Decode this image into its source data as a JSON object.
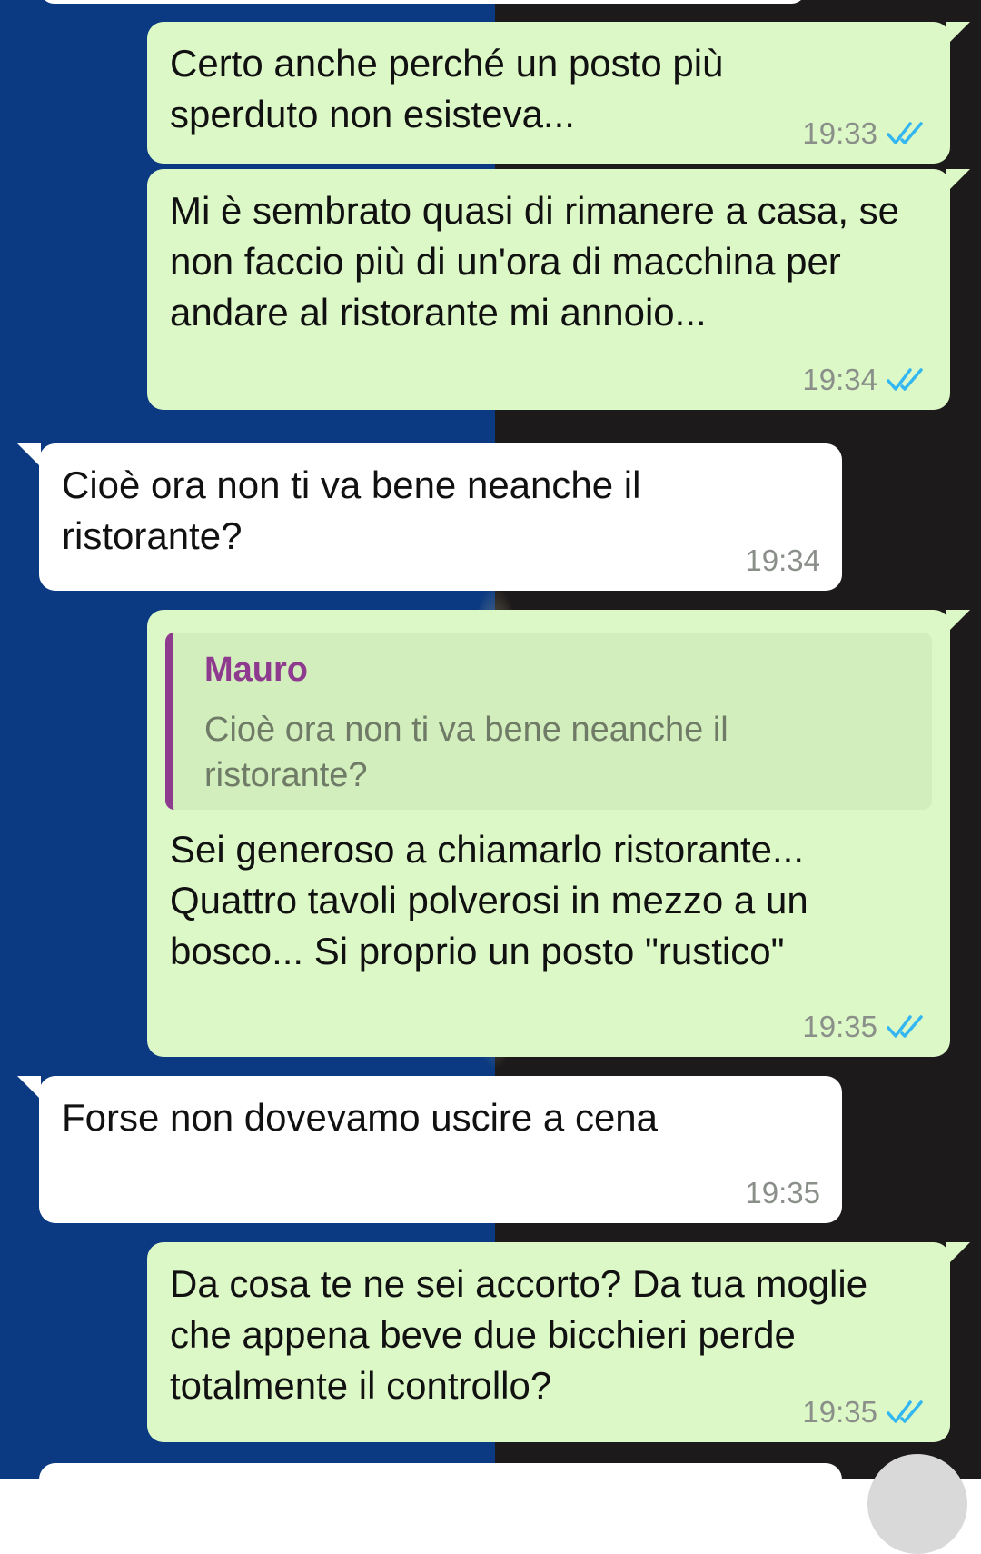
{
  "colors": {
    "outgoing_bubble": "#dcf8c6",
    "incoming_bubble": "#ffffff",
    "read_ticks": "#34b7f1",
    "quote_accent": "#8d3a8f",
    "background_left": "#0b3a82",
    "background_right": "#1c1a1a"
  },
  "messages": [
    {
      "direction": "out",
      "text": "Certo anche perché un posto più sperduto non esisteva...",
      "time": "19:33",
      "status": "read"
    },
    {
      "direction": "out",
      "text": "Mi è sembrato quasi di rimanere a casa, se non faccio più di un'ora di macchina per andare al ristorante mi annoio...",
      "time": "19:34",
      "status": "read"
    },
    {
      "direction": "in",
      "text": "Cioè ora non ti va bene neanche il ristorante?",
      "time": "19:34"
    },
    {
      "direction": "out",
      "quote": {
        "author": "Mauro",
        "text": "Cioè ora non ti va bene neanche il ristorante?"
      },
      "text": "Sei generoso a chiamarlo ristorante... Quattro tavoli polverosi in mezzo a un bosco... Si proprio un posto \"rustico\"",
      "time": "19:35",
      "status": "read"
    },
    {
      "direction": "in",
      "text": "Forse non dovevamo uscire a cena",
      "time": "19:35"
    },
    {
      "direction": "out",
      "text": "Da cosa te ne sei accorto? Da tua moglie che appena beve due bicchieri perde totalmente il controllo?",
      "time": "19:35",
      "status": "read"
    }
  ],
  "icons": {
    "read_status": "double-check-icon",
    "scroll_button": "scroll-down-button"
  }
}
